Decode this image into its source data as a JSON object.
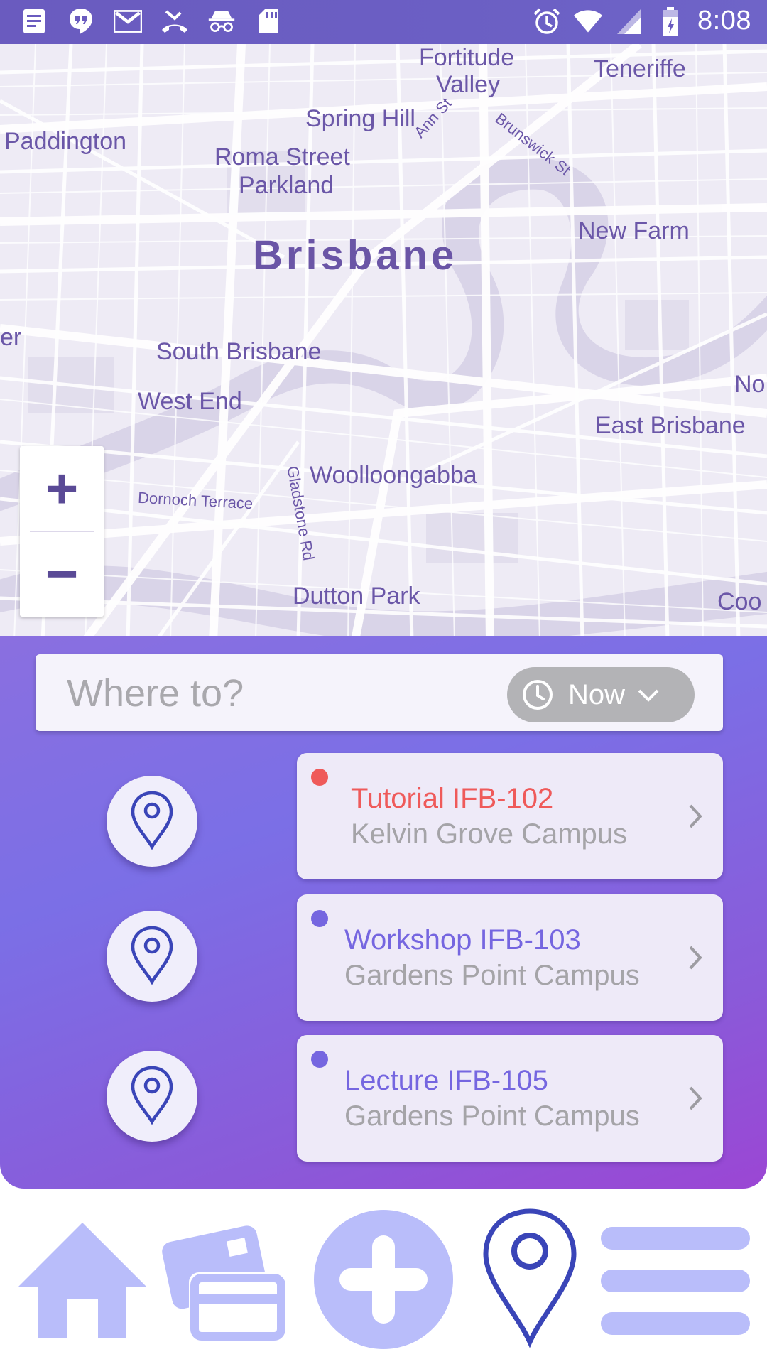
{
  "status_bar": {
    "time": "8:08",
    "left_icons": [
      "notes-icon",
      "hangouts-icon",
      "gmail-icon",
      "missed-call-icon",
      "incognito-icon",
      "sd-card-icon"
    ],
    "right_icons": [
      "alarm-icon",
      "wifi-icon",
      "signal-icon",
      "battery-icon"
    ]
  },
  "map": {
    "labels": {
      "fortitude": "Fortitude",
      "valley": "Valley",
      "teneriffe": "Teneriffe",
      "spring_hill": "Spring Hill",
      "paddington": "Paddington",
      "roma_street": "Roma Street",
      "parkland": "Parkland",
      "ann_st": "Ann St",
      "brunswick_st": "Brunswick St",
      "new_farm": "New Farm",
      "brisbane": "Brisbane",
      "er": "er",
      "south_brisbane": "South Brisbane",
      "no": "No",
      "west_end": "West End",
      "east_brisbane": "East Brisbane",
      "woolloongabba": "Woolloongabba",
      "dornoch": "Dornoch Terrace",
      "gladstone": "Gladstone Rd",
      "dutton_park": "Dutton Park",
      "coo": "Coo"
    },
    "zoom_in": "+",
    "zoom_out": "−"
  },
  "search": {
    "placeholder": "Where to?",
    "time_selector": "Now"
  },
  "colors": {
    "accent": "#7b6fe6",
    "panel_end": "#9b46d4",
    "alert": "#ef5a5a",
    "normal": "#7566e0",
    "pin": "#3a45b8",
    "nav_inactive": "#b9bdfa",
    "nav_active": "#3a45b8"
  },
  "schedule": [
    {
      "title": "Tutorial IFB-102",
      "location": "Kelvin Grove Campus",
      "status": "alert"
    },
    {
      "title": "Workshop IFB-103",
      "location": "Gardens Point Campus",
      "status": "normal"
    },
    {
      "title": "Lecture IFB-105",
      "location": "Gardens Point Campus",
      "status": "normal"
    }
  ],
  "bottom_nav": [
    {
      "icon": "home-icon",
      "active": false
    },
    {
      "icon": "cards-icon",
      "active": false
    },
    {
      "icon": "add-icon",
      "active": false
    },
    {
      "icon": "location-pin-icon",
      "active": true
    },
    {
      "icon": "menu-icon",
      "active": false
    }
  ]
}
